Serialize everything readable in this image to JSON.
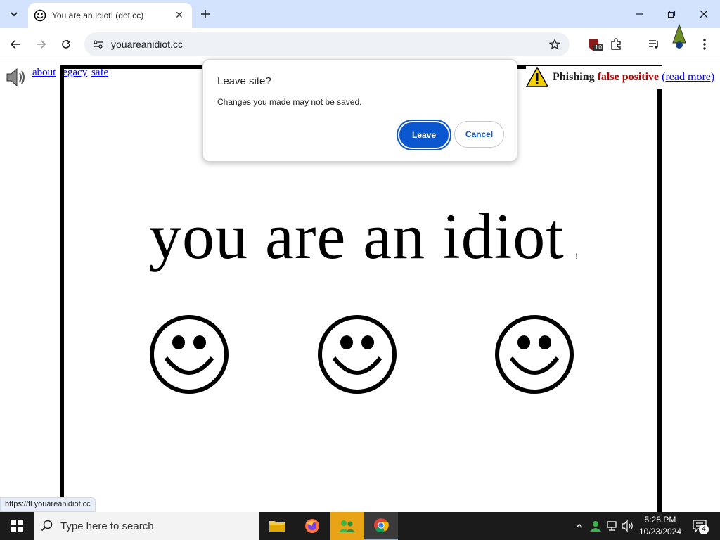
{
  "browser": {
    "tab_title": "You are an Idiot! (dot cc)",
    "new_tab_symbol": "+",
    "close_tab_symbol": "✕",
    "url": "youareanidiot.cc",
    "extension_badge": "10"
  },
  "page": {
    "links": [
      "about",
      "legacy",
      "safe"
    ],
    "phishing_label": "Phishing",
    "false_positive_label": "false positive",
    "read_more_label": "(read more)",
    "headline": "you are an idiot",
    "headline_suffix": "!",
    "status_url": "https://fl.youareanidiot.cc"
  },
  "dialog": {
    "title": "Leave site?",
    "message": "Changes you made may not be saved.",
    "leave_label": "Leave",
    "cancel_label": "Cancel"
  },
  "taskbar": {
    "search_placeholder": "Type here to search",
    "time": "5:28 PM",
    "date": "10/23/2024",
    "notification_count": "4"
  },
  "colors": {
    "tabstrip": "#d3e3fd",
    "accent": "#0b57d0",
    "false_positive": "#c00000",
    "link": "#0000ee"
  }
}
